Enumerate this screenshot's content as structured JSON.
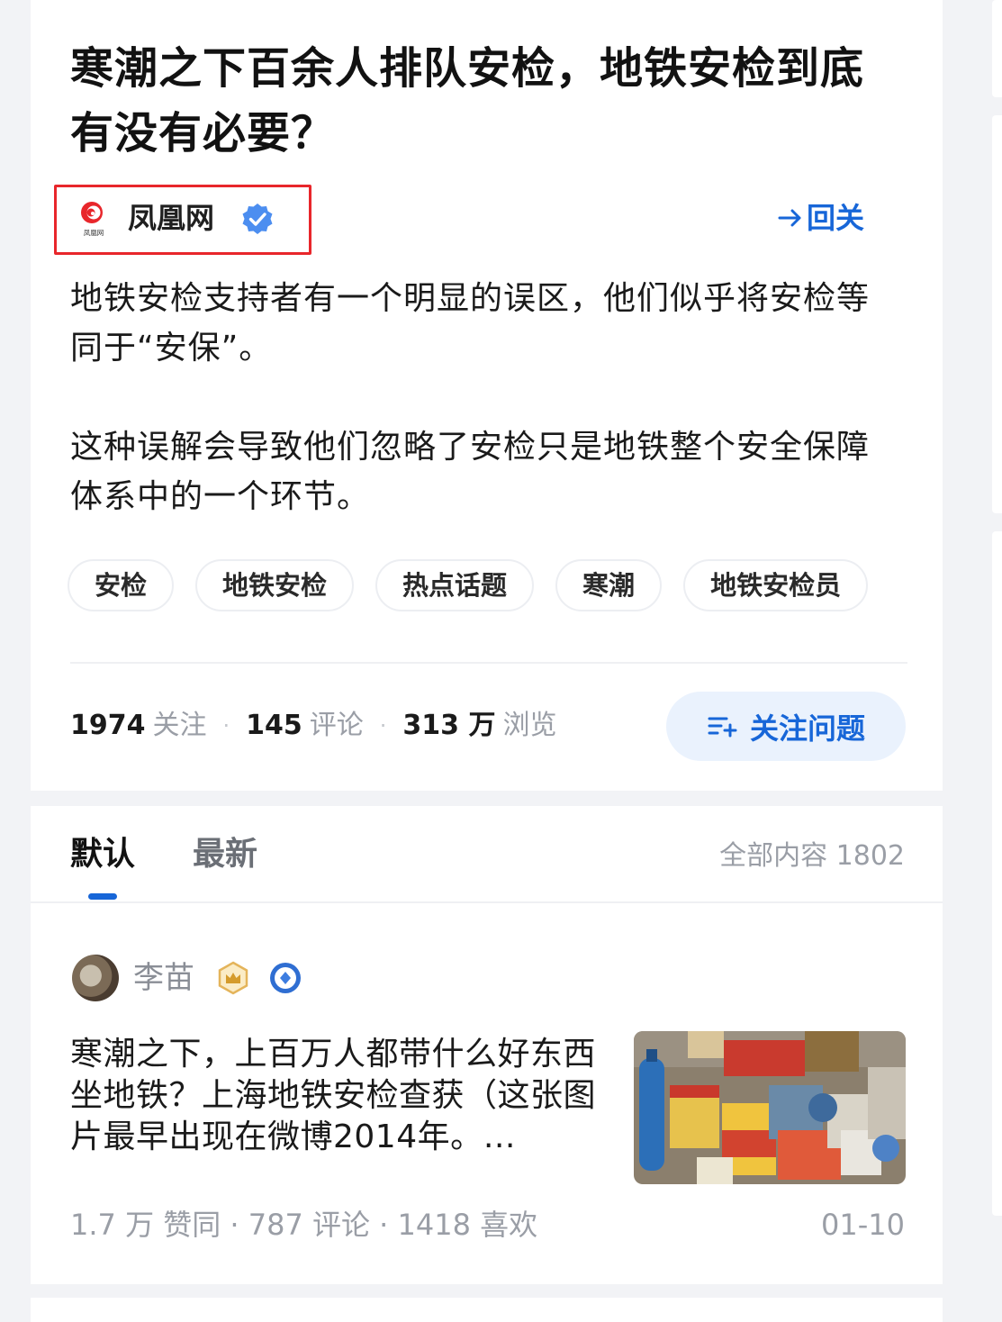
{
  "question": {
    "title": "寒潮之下百余人排队安检，地铁安检到底有没有必要？",
    "author_name": "凤凰网",
    "author_logo_text": "凤凰网",
    "follow_author_label": "回关",
    "desc_paragraphs": [
      "地铁安检支持者有一个明显的误区，他们似乎将安检等同于“安保”。",
      "这种误解会导致他们忽略了安检只是地铁整个安全保障体系中的一个环节。"
    ],
    "tags": [
      "安检",
      "地铁安检",
      "热点话题",
      "寒潮",
      "地铁安检员"
    ],
    "stats": {
      "followers_num": "1974",
      "followers_label": "关注",
      "comments_num": "145",
      "comments_label": "评论",
      "views_num": "313 万",
      "views_label": "浏览"
    },
    "follow_question_label": "关注问题"
  },
  "tabs": {
    "items": [
      {
        "label": "默认",
        "active": true
      },
      {
        "label": "最新",
        "active": false
      }
    ],
    "total_label": "全部内容 1802"
  },
  "answer": {
    "author_name": "李苗",
    "excerpt": "寒潮之下，上百万人都带什么好东西坐地铁？上海地铁安检查获（这张图片最早出现在微博2014年。…",
    "meta": "1.7 万 赞同 · 787  评论 · 1418  喜欢",
    "date": "01-10"
  },
  "colors": {
    "accent": "#1766d8",
    "highlight_box": "#e8262b",
    "follow_bg": "#eaf2fd"
  }
}
